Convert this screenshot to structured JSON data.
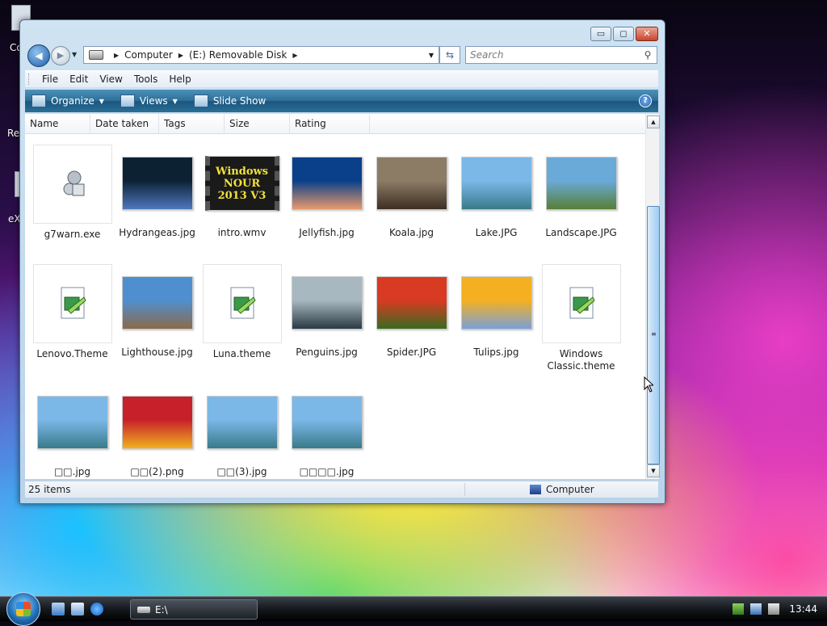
{
  "desktop": {
    "fragments": [
      "Co",
      "Re",
      "eX"
    ]
  },
  "window": {
    "controls": {
      "minimize": "▭",
      "maximize": "◻",
      "close": "✕"
    },
    "address": {
      "crumbs": [
        "Computer",
        "(E:) Removable Disk"
      ],
      "search_placeholder": "Search"
    },
    "menu": [
      "File",
      "Edit",
      "View",
      "Tools",
      "Help"
    ],
    "commands": {
      "organize": "Organize",
      "views": "Views",
      "slideshow": "Slide Show",
      "help": "?"
    },
    "columns": [
      "Name",
      "Date taken",
      "Tags",
      "Size",
      "Rating"
    ],
    "files": [
      {
        "name": "g7warn.exe",
        "kind": "exe"
      },
      {
        "name": "Hydrangeas.jpg",
        "kind": "photo",
        "colors": [
          "#0c2233",
          "#4f77c0"
        ]
      },
      {
        "name": "intro.wmv",
        "kind": "video",
        "overlay": "Windows NOUR 2013 V3"
      },
      {
        "name": "Jellyfish.jpg",
        "kind": "photo",
        "colors": [
          "#0a3f8a",
          "#e89a6c"
        ]
      },
      {
        "name": "Koala.jpg",
        "kind": "photo",
        "colors": [
          "#8c7c66",
          "#3c2e22"
        ]
      },
      {
        "name": "Lake.JPG",
        "kind": "photo",
        "colors": [
          "#7bb8e8",
          "#3a7a8a"
        ]
      },
      {
        "name": "Landscape.JPG",
        "kind": "photo",
        "colors": [
          "#6aaad8",
          "#567f36"
        ]
      },
      {
        "name": "Lenovo.Theme",
        "kind": "theme"
      },
      {
        "name": "Lighthouse.jpg",
        "kind": "photo",
        "colors": [
          "#4f8fd0",
          "#8a6a4a"
        ]
      },
      {
        "name": "Luna.theme",
        "kind": "theme"
      },
      {
        "name": "Penguins.jpg",
        "kind": "photo",
        "colors": [
          "#a8b8c0",
          "#2a3a44"
        ]
      },
      {
        "name": "Spider.JPG",
        "kind": "photo",
        "colors": [
          "#d83a22",
          "#3a6a20"
        ]
      },
      {
        "name": "Tulips.jpg",
        "kind": "photo",
        "colors": [
          "#f4b020",
          "#7aa0d8"
        ]
      },
      {
        "name": "Windows Classic.theme",
        "kind": "theme"
      },
      {
        "name": "□□.jpg",
        "kind": "photo",
        "colors": [
          "#7bb8e8",
          "#3a7a8a"
        ]
      },
      {
        "name": "□□(2).png",
        "kind": "photo",
        "colors": [
          "#c8202a",
          "#f0b020"
        ]
      },
      {
        "name": "□□(3).jpg",
        "kind": "photo",
        "colors": [
          "#7bb8e8",
          "#3a7a8a"
        ]
      },
      {
        "name": "□□□□.jpg",
        "kind": "photo",
        "colors": [
          "#7bb8e8",
          "#3a7a8a"
        ]
      }
    ],
    "status": {
      "count": "25 items",
      "zone": "Computer"
    }
  },
  "taskbar": {
    "task_label": "E:\\",
    "clock": "13:44"
  }
}
